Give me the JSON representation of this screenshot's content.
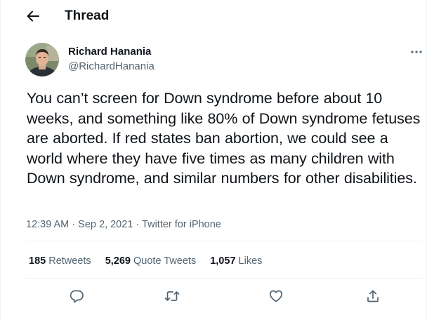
{
  "header": {
    "title": "Thread",
    "back_icon": "back-arrow-icon"
  },
  "tweet": {
    "author": {
      "name": "Richard Hanania",
      "handle": "@RichardHanania"
    },
    "text": "You can’t screen for Down syndrome before about 10 weeks, and something like 80% of Down syndrome fetuses are aborted. If red states ban abortion, we could see a world where they have five times as many children with Down syndrome, and similar numbers for other disabilities.",
    "time": "12:39 AM",
    "date": "Sep 2, 2021",
    "source": "Twitter for iPhone",
    "separator": "·",
    "stats": {
      "retweets_count": "185",
      "retweets_label": "Retweets",
      "quote_tweets_count": "5,269",
      "quote_tweets_label": "Quote Tweets",
      "likes_count": "1,057",
      "likes_label": "Likes"
    }
  },
  "actions": [
    "reply-icon",
    "retweet-icon",
    "like-icon",
    "share-icon"
  ],
  "colors": {
    "text": "#0f1419",
    "secondary": "#536471",
    "border": "#eff3f4"
  }
}
